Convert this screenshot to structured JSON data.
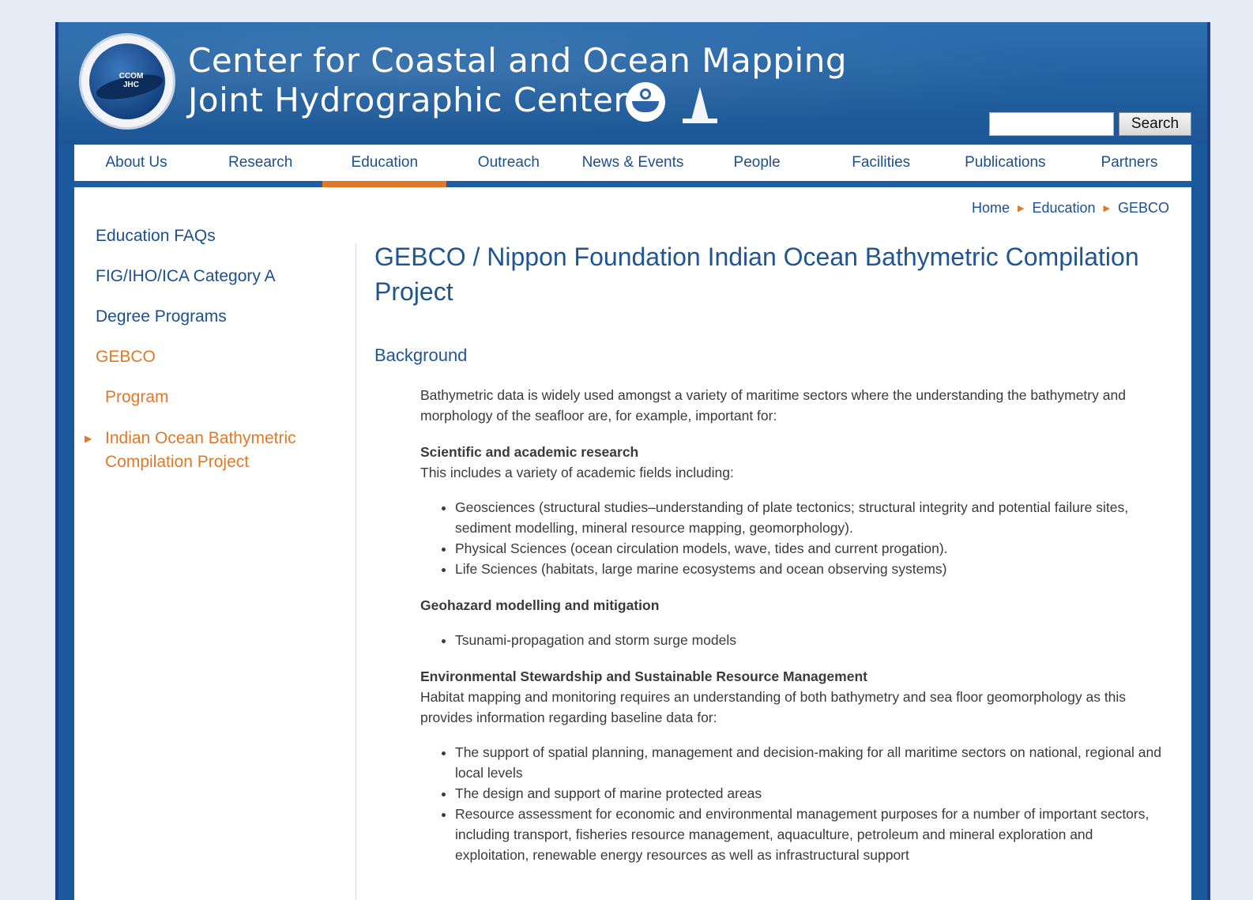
{
  "header": {
    "title_line1": "Center for Coastal and Ocean Mapping",
    "title_line2": "Joint Hydrographic Center",
    "logo_text": "CCOM JHC",
    "icons": [
      "noaa-logo-icon",
      "unh-lighthouse-icon"
    ],
    "search": {
      "value": "",
      "button_label": "Search"
    }
  },
  "nav": {
    "items": [
      "About Us",
      "Research",
      "Education",
      "Outreach",
      "News & Events",
      "People",
      "Facilities",
      "Publications",
      "Partners"
    ],
    "active": "Education"
  },
  "breadcrumb": {
    "items": [
      "Home",
      "Education",
      "GEBCO"
    ]
  },
  "sidebar": {
    "items": [
      {
        "label": "Education FAQs"
      },
      {
        "label": "FIG/IHO/ICA Category A"
      },
      {
        "label": "Degree Programs"
      },
      {
        "label": "GEBCO",
        "active": true
      },
      {
        "label": "Program",
        "sub": true
      },
      {
        "label": "Indian Ocean Bathymetric Compilation Project",
        "current": true
      }
    ]
  },
  "main": {
    "title": "GEBCO / Nippon Foundation Indian Ocean Bathymetric Compilation Project",
    "section": "Background",
    "intro": "Bathymetric data is widely used amongst a variety of maritime sectors where the understanding the bathymetry and morphology of the seafloor are, for example, important for:",
    "sci_heading": "Scientific and academic research",
    "sci_text": "This includes a variety of academic fields including:",
    "sci_list": [
      "Geosciences (structural studies–understanding of plate tectonics; structural integrity and potential failure sites, sediment modelling, mineral resource mapping, geomorphology).",
      "Physical Sciences (ocean circulation models, wave, tides and current progation).",
      "Life Sciences (habitats, large marine ecosystems and ocean observing systems)"
    ],
    "geo_heading": "Geohazard modelling and mitigation",
    "geo_list": [
      "Tsunami-propagation and storm surge models"
    ],
    "env_heading": "Environmental Stewardship and Sustainable Resource Management",
    "env_text": "Habitat mapping and monitoring requires an understanding of both bathymetry and sea floor geomorphology as this provides information regarding baseline data for:",
    "env_list": [
      "The support of spatial planning, management and decision-making for all maritime sectors on national, regional and local levels",
      "The design and support of marine protected areas",
      "Resource assessment for economic and environmental management purposes for a number of important sectors, including transport, fisheries resource management, aquaculture, petroleum and mineral exploration and exploitation, renewable energy resources as well as infrastructural support"
    ]
  },
  "colors": {
    "header_blue": "#2368aa",
    "nav_text": "#1d4f8f",
    "accent_orange": "#e0782a",
    "frame_border": "#1b3f88",
    "page_bg": "#e6ecf5"
  }
}
